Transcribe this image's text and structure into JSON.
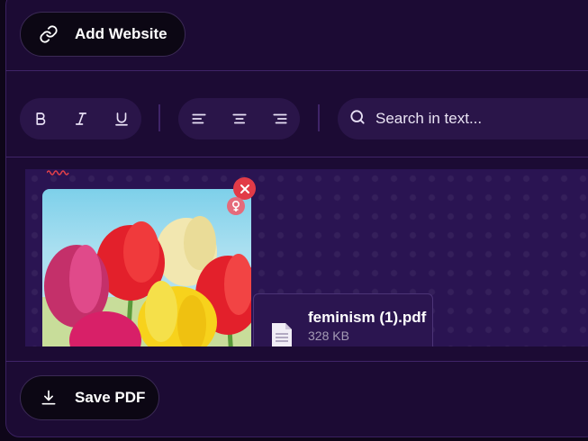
{
  "header": {
    "add_website_label": "Add Website"
  },
  "toolbar": {
    "format_buttons": [
      "bold",
      "italic",
      "underline"
    ],
    "align_buttons": [
      "align-left",
      "align-center",
      "align-right"
    ],
    "search_placeholder": "Search in text..."
  },
  "attachments": {
    "image": {
      "alt": "tulips"
    },
    "file": {
      "name": "feminism (1).pdf",
      "size": "328 KB"
    }
  },
  "footer": {
    "save_pdf_label": "Save PDF"
  },
  "colors": {
    "background": "#1c0b34",
    "button_bg": "#0c0714",
    "accent_red": "#e23b47",
    "toolbar_bg": "#2a1549"
  }
}
